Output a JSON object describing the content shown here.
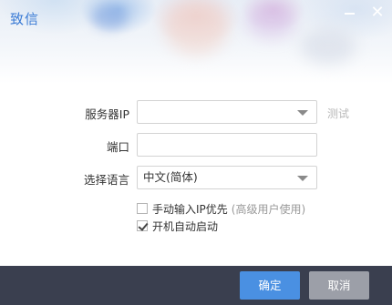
{
  "window": {
    "title": "致信",
    "minimize_icon": "minimize-icon",
    "close_icon": "close-icon",
    "close_glyph": "✕"
  },
  "form": {
    "server_ip": {
      "label": "服务器IP",
      "value": "",
      "test_link": "测试"
    },
    "port": {
      "label": "端口",
      "value": ""
    },
    "language": {
      "label": "选择语言",
      "selected": "中文(简体)"
    },
    "manual_ip": {
      "label": "手动输入IP优先",
      "note": "(高级用户使用)",
      "checked": false
    },
    "auto_start": {
      "label": "开机自动启动",
      "checked": true
    }
  },
  "footer": {
    "ok_label": "确定",
    "cancel_label": "取消"
  },
  "colors": {
    "title": "#3a7bd5",
    "footer_bg": "#3a3f4f",
    "ok_button": "#4a90e2",
    "cancel_button": "#9c9fa8"
  }
}
